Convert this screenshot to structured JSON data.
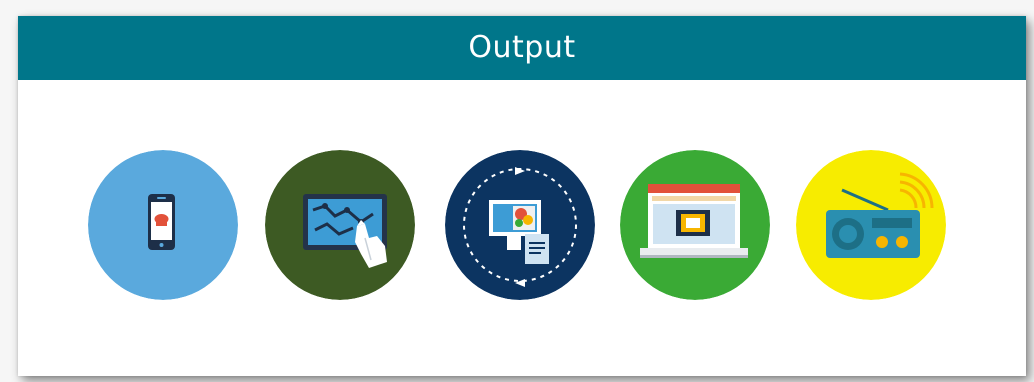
{
  "header": {
    "title": "Output"
  },
  "icons": [
    {
      "name": "mobile-phone-icon",
      "color": "#5aa9dd"
    },
    {
      "name": "touch-screen-map-icon",
      "color": "#3d5a23"
    },
    {
      "name": "media-sync-icon",
      "color": "#0c3461"
    },
    {
      "name": "web-browser-icon",
      "color": "#3aaa35"
    },
    {
      "name": "radio-icon",
      "color": "#f7ec00"
    }
  ]
}
